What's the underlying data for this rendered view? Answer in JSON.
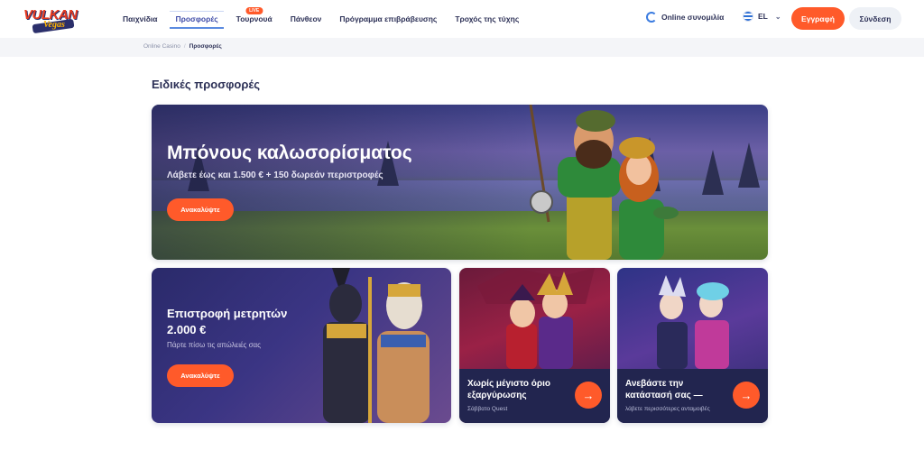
{
  "header": {
    "logo_text": "VULKAN",
    "logo_sub": "Vegas",
    "nav": [
      {
        "label": "Παιχνίδια"
      },
      {
        "label": "Προσφορές"
      },
      {
        "label": "Τουρνουά",
        "badge": "LIVE"
      },
      {
        "label": "Πάνθεον"
      },
      {
        "label": "Πρόγραμμα επιβράβευσης"
      },
      {
        "label": "Τροχός της τύχης"
      }
    ],
    "support_label": "Online συνομιλία",
    "language": "EL",
    "register_label": "Εγγραφή",
    "login_label": "Σύνδεση"
  },
  "breadcrumb": {
    "home": "Online Casino",
    "current": "Προσφορές"
  },
  "page": {
    "title": "Ειδικές προσφορές"
  },
  "offers": {
    "welcome": {
      "title": "Μπόνους καλωσορίσματος",
      "subtitle": "Λάβετε έως και 1.500 € + 150 δωρεάν περιστροφές",
      "cta": "Ανακαλύψτε"
    },
    "cashback": {
      "title": "Επιστροφή μετρητών 2.000 €",
      "subtitle": "Πάρτε πίσω τις απώλειές σας",
      "cta": "Ανακαλύψτε"
    },
    "no_limit": {
      "title": "Χωρίς μέγιστο όριο εξαργύρωσης",
      "subtitle": "Σάββατο Quest"
    },
    "level_up": {
      "title": "Ανεβάστε την κατάστασή σας —",
      "subtitle": "λάβετε περισσότερες ανταμοιβές"
    }
  },
  "colors": {
    "accent": "#ff5a2a",
    "text_dark": "#2d3157",
    "nav_active": "#3f4ca8"
  }
}
